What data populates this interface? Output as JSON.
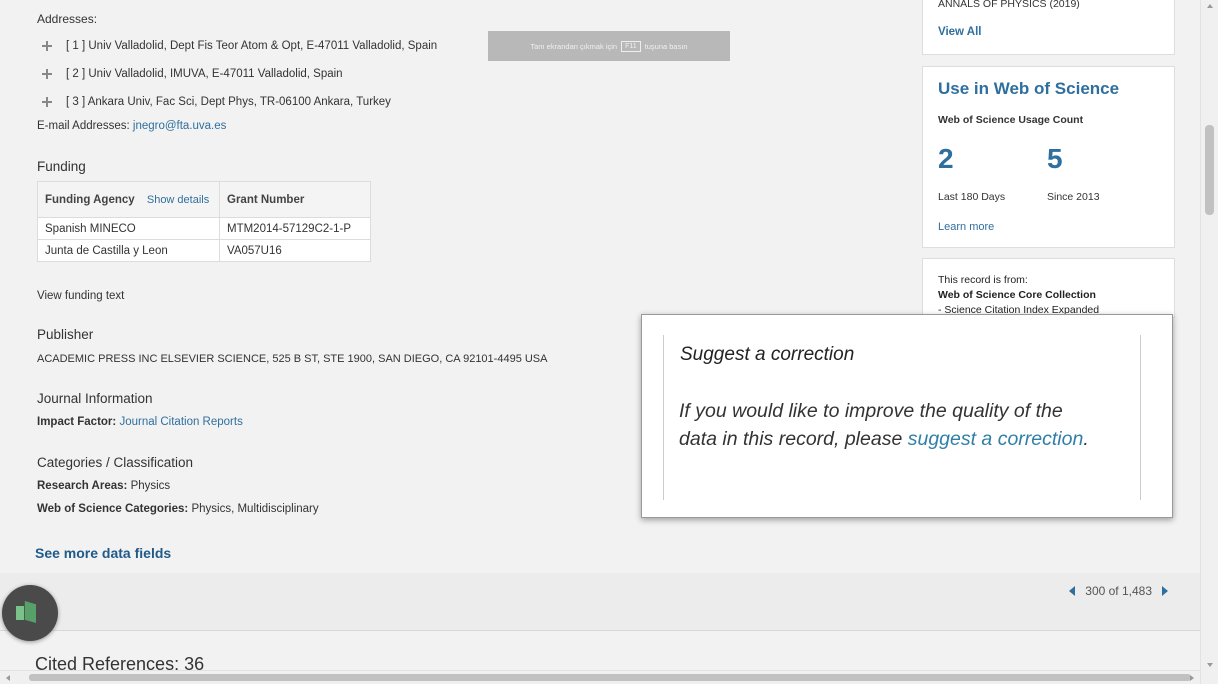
{
  "addresses": {
    "heading": "Addresses:",
    "items": [
      "[ 1 ] Univ Valladolid, Dept Fis Teor Atom & Opt, E-47011 Valladolid, Spain",
      "[ 2 ] Univ Valladolid, IMUVA, E-47011 Valladolid, Spain",
      "[ 3 ] Ankara Univ, Fac Sci, Dept Phys, TR-06100 Ankara, Turkey"
    ],
    "email_label": "E-mail Addresses:",
    "email": "jnegro@fta.uva.es"
  },
  "fullscreen_hint": {
    "before": "Tam ekrandan çıkmak için",
    "key": "F11",
    "after": "tuşuna basın"
  },
  "funding": {
    "title": "Funding",
    "col_agency": "Funding Agency",
    "show_details": "Show details",
    "col_grant": "Grant Number",
    "rows": [
      {
        "agency": "Spanish MINECO",
        "grant": "MTM2014-57129C2-1-P"
      },
      {
        "agency": "Junta de Castilla y Leon",
        "grant": "VA057U16"
      }
    ],
    "view_text": "View funding text"
  },
  "publisher": {
    "title": "Publisher",
    "text": "ACADEMIC PRESS INC ELSEVIER SCIENCE, 525 B ST, STE 1900, SAN DIEGO, CA 92101-4495 USA"
  },
  "journal": {
    "title": "Journal Information",
    "impact_label": "Impact Factor:",
    "impact_link": "Journal Citation Reports"
  },
  "categories": {
    "title": "Categories / Classification",
    "research_label": "Research Areas:",
    "research_value": "Physics",
    "wos_label": "Web of Science Categories:",
    "wos_value": "Physics, Multidisciplinary"
  },
  "see_more": "See more data fields",
  "pager": {
    "text": "300 of 1,483"
  },
  "cited": "Cited References: 36",
  "sidebar": {
    "top_card": {
      "journal": "ANNALS OF PHYSICS (2019)",
      "view_all": "View All"
    },
    "usage": {
      "title": "Use in Web of Science",
      "subtitle": "Web of Science Usage Count",
      "count_180": "2",
      "label_180": "Last 180 Days",
      "count_2013": "5",
      "label_2013": "Since 2013",
      "learn_more": "Learn more"
    },
    "record": {
      "line1": "This record is from:",
      "line2": "Web of Science Core Collection",
      "line3": "- Science Citation Index Expanded"
    }
  },
  "popup": {
    "title": "Suggest a correction",
    "text_before": "If you would like to improve the quality of the data in this record, please ",
    "link": "suggest a correction",
    "text_after": "."
  },
  "colors": {
    "accent": "#2f6f9f",
    "link_dark": "#1f5a8a"
  }
}
